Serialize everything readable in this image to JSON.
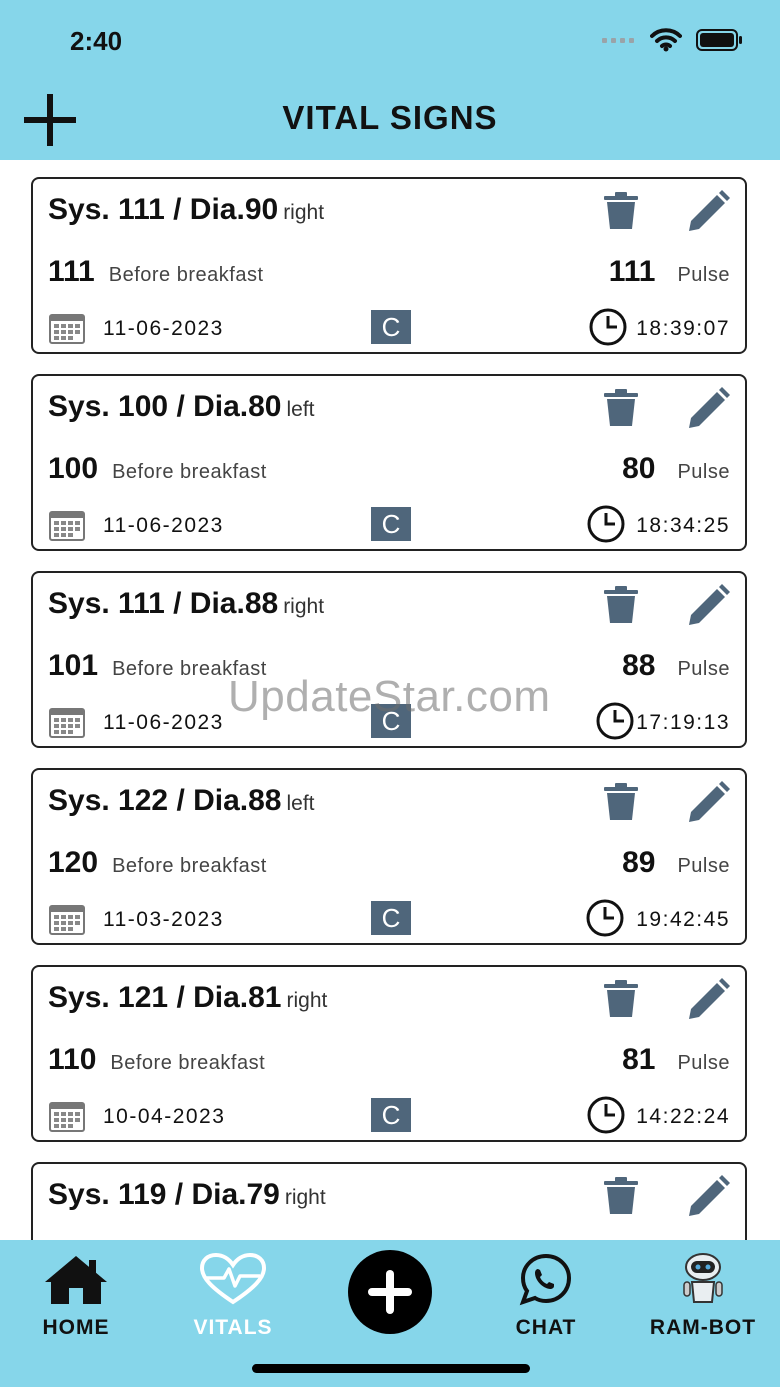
{
  "status_bar": {
    "time": "2:40"
  },
  "header": {
    "title": "VITAL SIGNS"
  },
  "records": [
    {
      "title": "Sys. 111  /  Dia.90",
      "side": "right",
      "reading": "111",
      "meal": "Before breakfast",
      "pulse": "111",
      "pulse_label": "Pulse",
      "date": "11-06-2023",
      "badge": "C",
      "time": "18:39:07"
    },
    {
      "title": "Sys. 100  /  Dia.80",
      "side": "left",
      "reading": "100",
      "meal": "Before breakfast",
      "pulse": "80",
      "pulse_label": "Pulse",
      "date": "11-06-2023",
      "badge": "C",
      "time": "18:34:25"
    },
    {
      "title": "Sys. 111  /  Dia.88",
      "side": "right",
      "reading": "101",
      "meal": "Before breakfast",
      "pulse": "88",
      "pulse_label": "Pulse",
      "date": "11-06-2023",
      "badge": "C",
      "time": "17:19:13"
    },
    {
      "title": "Sys. 122  /  Dia.88",
      "side": "left",
      "reading": "120",
      "meal": "Before breakfast",
      "pulse": "89",
      "pulse_label": "Pulse",
      "date": "11-03-2023",
      "badge": "C",
      "time": "19:42:45"
    },
    {
      "title": "Sys. 121  /  Dia.81",
      "side": "right",
      "reading": "110",
      "meal": "Before breakfast",
      "pulse": "81",
      "pulse_label": "Pulse",
      "date": "10-04-2023",
      "badge": "C",
      "time": "14:22:24"
    },
    {
      "title": "Sys. 119  /  Dia.79",
      "side": "right",
      "reading": "",
      "meal": "",
      "pulse": "",
      "pulse_label": "",
      "date": "",
      "badge": "",
      "time": ""
    }
  ],
  "watermark": "UpdateStar.com",
  "tabs": [
    {
      "label": "HOME",
      "icon": "home-icon"
    },
    {
      "label": "VITALS",
      "icon": "heart-pulse-icon"
    },
    {
      "label": "",
      "icon": "plus-icon"
    },
    {
      "label": "CHAT",
      "icon": "whatsapp-icon"
    },
    {
      "label": "RAM-BOT",
      "icon": "robot-icon"
    }
  ],
  "colors": {
    "accent": "#86d6ea",
    "icon_slate": "#4f667b",
    "active_tab": "#ffffff"
  }
}
